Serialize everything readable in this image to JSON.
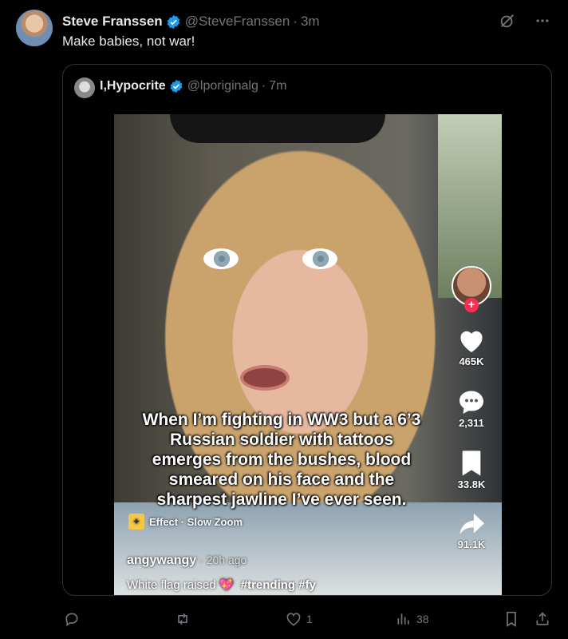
{
  "tweet": {
    "author_name": "Steve Franssen",
    "author_handle": "@SteveFranssen",
    "time": "3m",
    "text": "Make babies, not war!"
  },
  "quote": {
    "author_name": "I,Hypocrite",
    "author_handle": "@lporiginalg",
    "time": "7m"
  },
  "video": {
    "caption": "When I’m fighting in WW3 but a 6’3 Russian soldier with tattoos emerges from the bushes, blood smeared on his face and the sharpest jawline I’ve ever seen.",
    "effect_label": "Effect · Slow Zoom",
    "username": "angywangy",
    "posted": "· 20h ago",
    "description": "White flag raised",
    "hashtags": "#trending #fy",
    "likes": "465K",
    "comments": "2,311",
    "saves": "33.8K",
    "shares": "91.1K"
  },
  "actions": {
    "likes": "1",
    "views": "38"
  },
  "colors": {
    "accent": "#1d9bf0",
    "muted": "#71767b",
    "tiktok_red": "#fe2c55"
  },
  "icons": [
    "verified-badge-icon",
    "grok-icon",
    "more-icon",
    "reply-icon",
    "retweet-icon",
    "like-icon",
    "views-icon",
    "bookmark-icon",
    "share-icon",
    "heart-icon",
    "comment-icon",
    "save-icon",
    "share-arrow-icon"
  ]
}
